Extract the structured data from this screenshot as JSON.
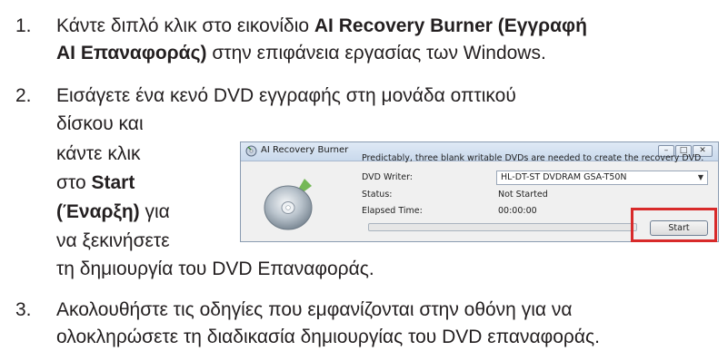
{
  "steps": [
    {
      "number": "1.",
      "line1": {
        "pre": "Κάντε διπλό κλικ στο εικονίδιο ",
        "bold": "AI Recovery Burner (Εγγραφή"
      },
      "line2": {
        "bold": "AI Επαναφοράς)",
        "post": " στην επιφάνεια εργασίας των Windows."
      }
    },
    {
      "number": "2.",
      "line1": "Εισάγετε ένα κενό DVD εγγραφής στη μονάδα οπτικού",
      "line2": "δίσκου και",
      "line3": "κάντε κλικ",
      "line4": {
        "pre": "στο ",
        "bold": "Start"
      },
      "line5": {
        "bold": "(Έναρξη)",
        "post": " για"
      },
      "line6": "να ξεκινήσετε",
      "line7": "τη δημιουργία του DVD Επαναφοράς."
    },
    {
      "number": "3.",
      "line1": "Ακολουθήστε τις οδηγίες που εμφανίζονται στην οθόνη για να",
      "line2": "ολοκληρώσετε τη διαδικασία δημιουργίας του DVD επαναφοράς."
    }
  ],
  "dialog": {
    "title": "AI Recovery Burner",
    "message": "Predictably, three blank writable DVDs are needed to create the recovery DVD.",
    "writer_label": "DVD Writer:",
    "writer_value": "HL-DT-ST DVDRAM GSA-T50N",
    "status_label": "Status:",
    "status_value": "Not Started",
    "elapsed_label": "Elapsed Time:",
    "elapsed_value": "00:00:00",
    "progress": 0,
    "start_label": "Start",
    "highlight_color": "#d82a2a",
    "icons": [
      "app-icon",
      "disc-icon",
      "minimize-icon",
      "maximize-icon",
      "close-icon",
      "dropdown-arrow-icon"
    ]
  }
}
